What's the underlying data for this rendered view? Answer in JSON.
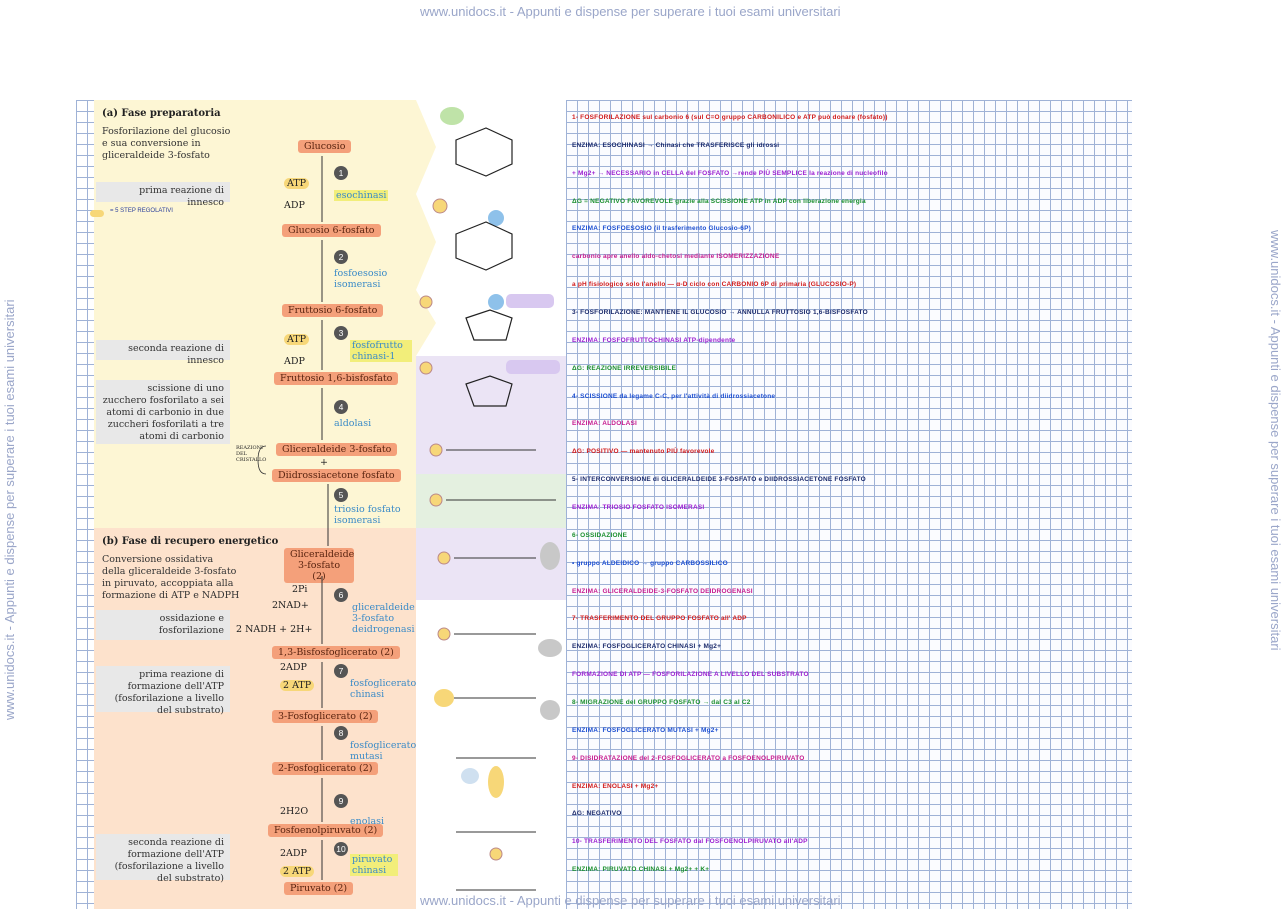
{
  "watermark": {
    "top": "www.unidocs.it - Appunti e dispense per superare i tuoi esami universitari",
    "bottom": "www.unidocs.it - Appunti e dispense per superare i tuoi esami universitari",
    "left": "www.unidocs.it - Appunti e dispense per superare i tuoi esami universitari",
    "right": "www.unidocs.it - Appunti e dispense per superare i tuoi esami universitari"
  },
  "colors": {
    "preparatoria_bg": "#fdf6d4",
    "recupero_bg": "#fde2cc",
    "metabolite": "#f4a07a",
    "enzyme": "#3b8bc7",
    "highlight": "#f2ee7a"
  },
  "legend": {
    "text": "= 5 STEP REGOLATIVI"
  },
  "fase_a": {
    "title": "(a)  Fase preparatoria",
    "desc": [
      "Fosforilazione del glucosio",
      "e sua conversione in",
      "gliceraldeide 3-fosfato"
    ],
    "notes": [
      "prima reazione di innesco",
      "seconda reazione di innesco",
      "scissione di uno zucchero fosforilato a sei atomi di carbonio in due zuccheri fosforilati a tre atomi di carbonio"
    ],
    "bracket_note": "REAZIONI DEL CRISTALLO"
  },
  "fase_b": {
    "title": "(b)  Fase di recupero energetico",
    "desc": [
      "Conversione ossidativa",
      "della gliceraldeide 3-fosfato",
      "in piruvato, accoppiata alla",
      "formazione di ATP e NADPH"
    ],
    "notes": [
      "ossidazione e fosforilazione",
      "prima reazione di formazione dell'ATP (fosforilazione a livello del substrato)",
      "seconda reazione di formazione dell'ATP (fosforilazione a livello del substrato)"
    ]
  },
  "metabolites": [
    "Glucosio",
    "Glucosio 6-fosfato",
    "Fruttosio 6-fosfato",
    "Fruttosio 1,6-bisfosfato",
    "Gliceraldeide 3-fosfato",
    "+",
    "Diidrossiacetone fosfato",
    "Gliceraldeide 3-fosfato (2)",
    "1,3-Bisfosfoglicerato (2)",
    "3-Fosfoglicerato (2)",
    "2-Fosfoglicerato (2)",
    "Fosfoenolpiruvato (2)",
    "Piruvato (2)"
  ],
  "enzymes": [
    "esochinasi",
    "fosfoesosio isomerasi",
    "fosfofrutto chinasi-1",
    "aldolasi",
    "triosio fosfato isomerasi",
    "gliceraldeide 3-fosfato deidrogenasi",
    "fosfoglicerato chinasi",
    "fosfoglicerato mutasi",
    "enolasi",
    "piruvato chinasi"
  ],
  "steps": [
    "1",
    "2",
    "3",
    "4",
    "5",
    "6",
    "7",
    "8",
    "9",
    "10"
  ],
  "cofactors": {
    "atp": "ATP",
    "adp": "ADP",
    "two_pi": "2Pi",
    "two_nad": "2NAD+",
    "two_nadh": "2 NADH + 2H+",
    "two_adp": "2ADP",
    "two_atp": "2 ATP",
    "two_h2o": "2H2O"
  },
  "notes": [
    "1- FOSFORILAZIONE sul carbonio 6 (sul C=O gruppo CARBONILICO e ATP può donare (fosfato))",
    "ENZIMA: ESOCHINASI → Chinasi che TRASFERISCE gli idrossi",
    "+ Mg2+ → NECESSARIO in CELLA del FOSFATO →rende PIÙ SEMPLICE la reazione di nucleofilo",
    "ΔG = NEGATIVO FAVOREVOLE grazie alla SCISSIONE ATP in ADP con liberazione energia",
    "ENZIMA: FOSFOESOSIO (il trasferimento Glucosio-6P)",
    "carbonio apre anello aldo-chetosi mediante ISOMERIZZAZIONE",
    "a pH fisiologico solo l'anello — α-D ciclo con CARBONIO 6P di primaria (GLUCOSIO-P)",
    "3- FOSFORILAZIONE: MANTIENE IL GLUCOSIO → ANNULLA FRUTTOSIO 1,6-BISFOSFATO",
    "ENZIMA: FOSFOFRUTTOCHINASI ATP-dipendente",
    "ΔG: REAZIONE IRREVERSIBILE",
    "4- SCISSIONE da legame C-C, per l'attività di diidrossiacetone",
    "ENZIMA: ALDOLASI",
    "ΔG: POSITIVO — mantenuto PIÙ favorevole",
    "5- INTERCONVERSIONE di GLICERALDEIDE 3-FOSFATO e DIIDROSSIACETONE FOSFATO",
    "ENZIMA: TRIOSIO FOSFATO ISOMERASI",
    "6- OSSIDAZIONE",
    "• gruppo ALDEIDICO → gruppo CARBOSSILICO",
    "ENZIMA: GLICERALDEIDE-3-FOSFATO DEIDROGENASI",
    "7- TRASFERIMENTO DEL GRUPPO FOSFATO all' ADP",
    "ENZIMA: FOSFOGLICERATO CHINASI + Mg2+",
    "FORMAZIONE DI ATP — FOSFORILAZIONE A LIVELLO DEL SUBSTRATO",
    "8- MIGRAZIONE del GRUPPO FOSFATO → dal C3 al C2",
    "ENZIMA: FOSFOGLICERATO MUTASI + Mg2+",
    "9- DISIDRATAZIONE del 2-FOSFOGLICERATO a FOSFOENOLPIRUVATO",
    "ENZIMA: ENOLASI + Mg2+",
    "ΔG: NEGATIVO",
    "10- TRASFERIMENTO DEL FOSFATO dal FOSFOENOLPIRUVATO all'ADP",
    "ENZIMA: PIRUVATO CHINASI + Mg2+ + K+"
  ]
}
